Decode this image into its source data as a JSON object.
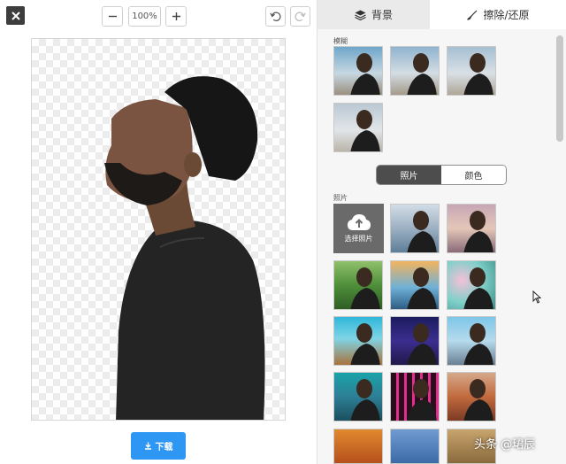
{
  "toolbar": {
    "close_icon": "close-icon",
    "zoom_out_icon": "minus-icon",
    "zoom_level": "100%",
    "zoom_in_icon": "plus-icon",
    "undo_icon": "undo-icon",
    "redo_icon": "redo-icon"
  },
  "download": {
    "label": "下载",
    "icon": "download-icon"
  },
  "tabs": [
    {
      "label": "背景",
      "icon": "layers-icon",
      "active": true
    },
    {
      "label": "擦除/还原",
      "icon": "brush-icon",
      "active": false
    }
  ],
  "blur_section": {
    "label": "模糊"
  },
  "segment": {
    "photo": "照片",
    "color": "颜色",
    "selected": "照片"
  },
  "photo_section": {
    "label": "照片",
    "upload_label": "选择照片"
  },
  "watermark": {
    "text": "头条 @珺辰"
  },
  "colors": {
    "accent": "#2e97f3",
    "segment_active": "#4d4d4d",
    "close_bg": "#3d3d3d"
  }
}
